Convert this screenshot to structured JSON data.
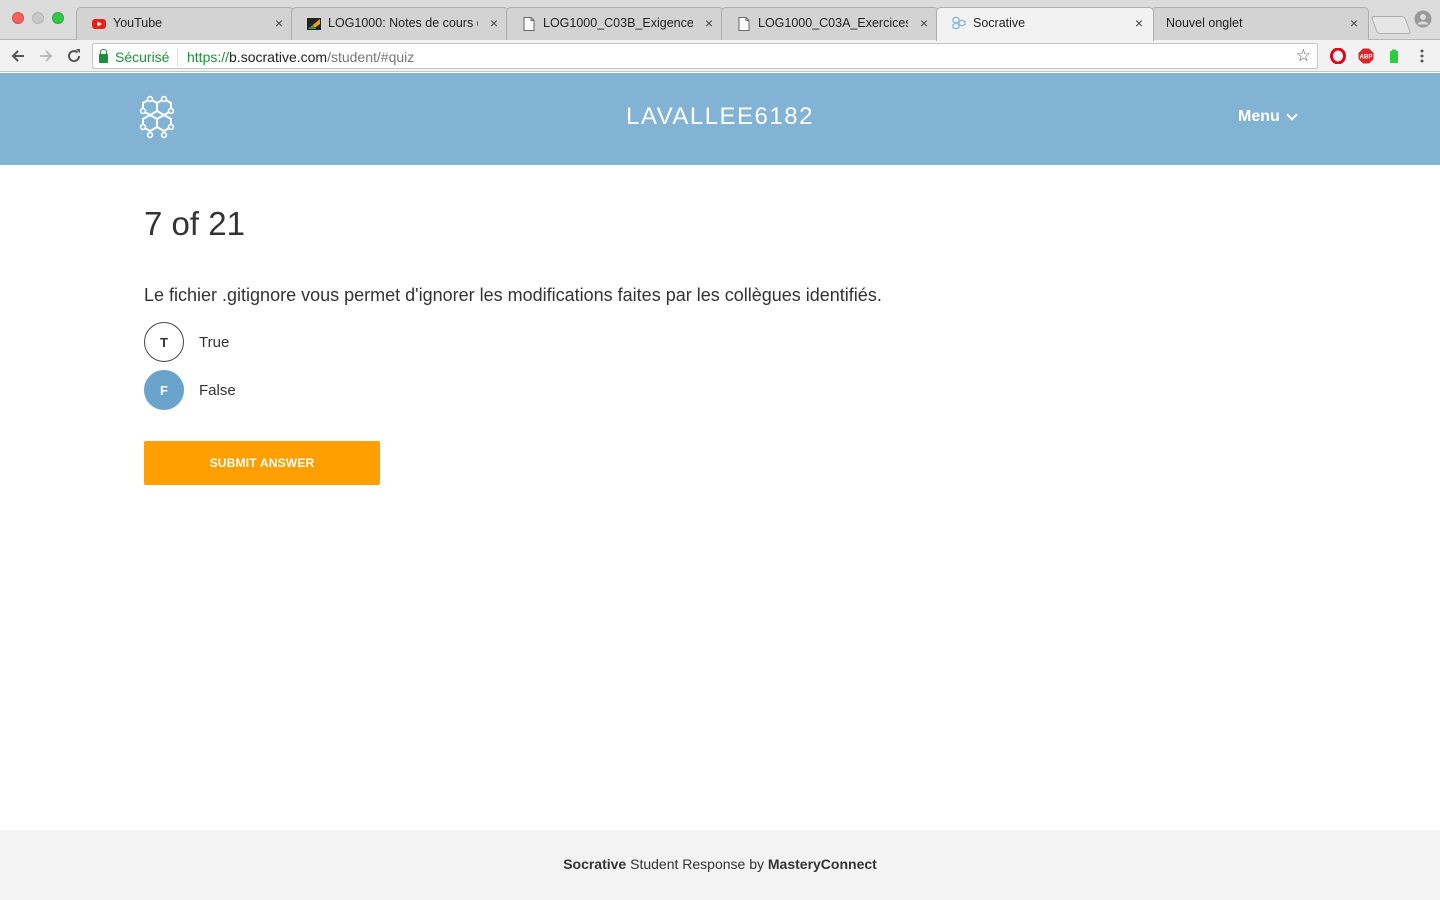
{
  "browser": {
    "tabs": [
      {
        "title": "YouTube",
        "icon": "youtube-icon",
        "active": false
      },
      {
        "title": "LOG1000: Notes de cours du",
        "icon": "moodle-icon",
        "active": false
      },
      {
        "title": "LOG1000_C03B_Exigences.p",
        "icon": "document-icon",
        "active": false
      },
      {
        "title": "LOG1000_C03A_ExercicesGi",
        "icon": "document-icon",
        "active": false
      },
      {
        "title": "Socrative",
        "icon": "socrative-icon",
        "active": true
      },
      {
        "title": "Nouvel onglet",
        "icon": "",
        "active": false
      }
    ],
    "secure_label": "Sécurisé",
    "url": {
      "scheme": "https://",
      "host": "b.socrative.com",
      "path": "/student/#quiz"
    },
    "colors": {
      "secure_green": "#1e8f3a"
    }
  },
  "header": {
    "room_name": "LAVALLEE6182",
    "menu_label": "Menu",
    "background": "#83b3d4"
  },
  "quiz": {
    "progress": "7 of 21",
    "question": "Le fichier .gitignore vous permet d'ignorer les modifications faites par les collègues identifiés.",
    "options": [
      {
        "letter": "T",
        "label": "True",
        "selected": false
      },
      {
        "letter": "F",
        "label": "False",
        "selected": true
      }
    ],
    "submit_label": "SUBMIT ANSWER",
    "accent": "#ff9f00"
  },
  "footer": {
    "brand": "Socrative",
    "middle": " Student Response by ",
    "company": "MasteryConnect"
  }
}
